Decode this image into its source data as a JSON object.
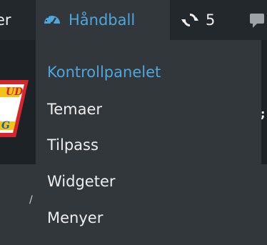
{
  "adminbar": {
    "partial_label": "er",
    "site_name": "Håndball",
    "updates_count": "5",
    "icons": [
      "dashboard-icon",
      "updates-icon",
      "comment-icon"
    ]
  },
  "colors": {
    "bar_bg": "#23282d",
    "menu_bg": "#32373c",
    "accent": "#4ea6dc",
    "text": "#eeeeee"
  },
  "menu": {
    "items": [
      {
        "label": "Kontrollpanelet",
        "active": true
      },
      {
        "label": "Temaer",
        "active": false
      },
      {
        "label": "Tilpass",
        "active": false
      },
      {
        "label": "Widgeter",
        "active": false
      },
      {
        "label": "Menyer",
        "active": false
      }
    ]
  },
  "logo": {
    "top_text": "UD",
    "bottom_text": "G"
  }
}
